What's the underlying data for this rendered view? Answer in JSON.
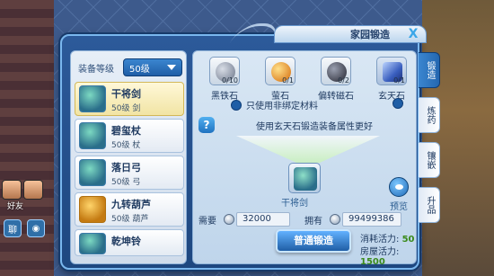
{
  "window": {
    "title": "家园锻造",
    "close_label": "X"
  },
  "equip_level": {
    "label": "装备等级",
    "selected": "50级"
  },
  "items": [
    {
      "name": "干将剑",
      "sub": "50级  剑"
    },
    {
      "name": "碧玺杖",
      "sub": "50级  杖"
    },
    {
      "name": "落日弓",
      "sub": "50级  弓"
    },
    {
      "name": "九转葫芦",
      "sub": "50级  葫芦"
    },
    {
      "name": "乾坤铃",
      "sub": ""
    }
  ],
  "materials": [
    {
      "name": "黑铁石",
      "count": "0/10",
      "color": "#8a95a8"
    },
    {
      "name": "萤石",
      "count": "0/1",
      "color": "#f29a1e"
    },
    {
      "name": "偏转磁石",
      "count": "0/2",
      "color": "#4a4a5a"
    },
    {
      "name": "玄天石",
      "count": "0/1",
      "color": "#4a78c8"
    }
  ],
  "bind_text": "只使用非绑定材料",
  "tip": "使用玄天石锻造装备属性更好",
  "help_label": "?",
  "result": {
    "name": "干将剑"
  },
  "preview_label": "预览",
  "cost": {
    "need_label": "需要",
    "need_value": "32000",
    "have_label": "拥有",
    "have_value": "99499386"
  },
  "forge_button": "普通锻造",
  "vitality": {
    "cost_label": "消耗活力:",
    "cost_value": "50",
    "house_label": "房屋活力:",
    "house_value": "1500"
  },
  "side_tabs": [
    "锻造",
    "炼药",
    "镶嵌",
    "升品"
  ],
  "hud": {
    "friend_label": "好友",
    "chat_label": "聊"
  }
}
